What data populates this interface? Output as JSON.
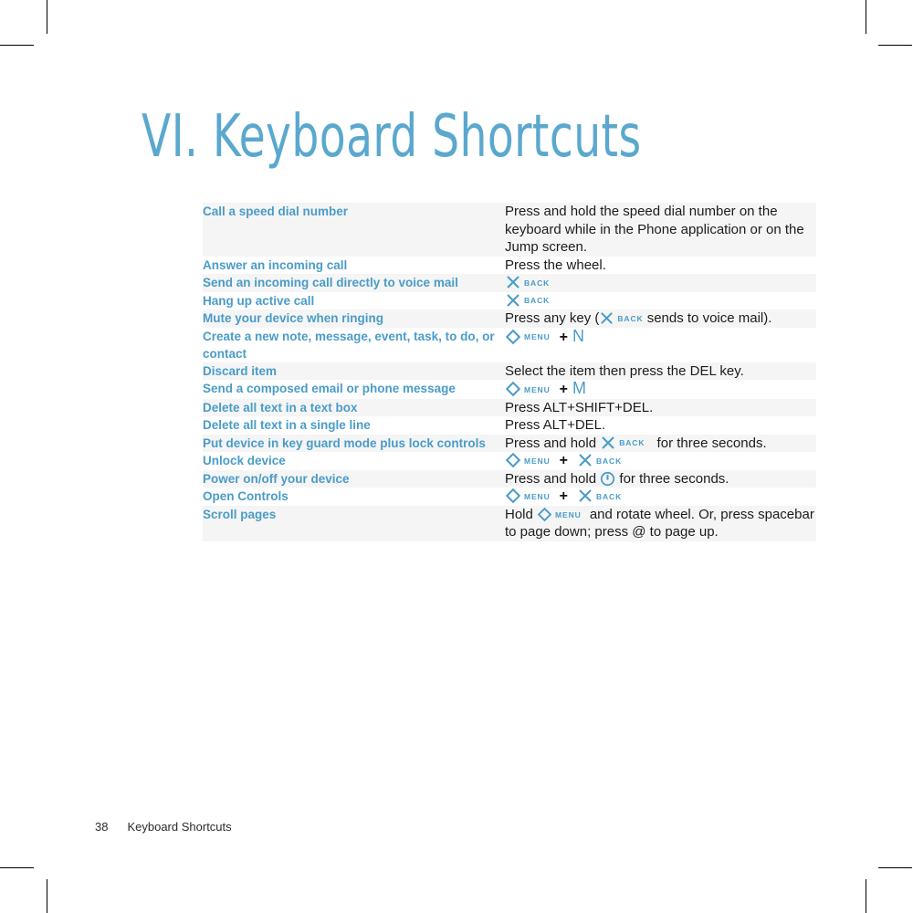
{
  "page": {
    "title": "VI. Keyboard Shortcuts",
    "footer_page_number": "38",
    "footer_section": "Keyboard Shortcuts"
  },
  "colors": {
    "accent_blue": "#4a9cc8",
    "title_blue": "#5aa8ce",
    "stripe_gray": "#f5f5f5",
    "body_black": "#1c1c1c"
  },
  "keys": {
    "back_label": "BACK",
    "menu_label": "MENU",
    "plus": "+",
    "power_label": "power"
  },
  "table": {
    "rows": [
      {
        "action": "Call a speed dial number",
        "desc_text": "Press and hold the speed dial number on the keyboard while in the Phone application or on the Jump screen."
      },
      {
        "action": "Answer an incoming call",
        "desc_text": "Press the wheel."
      },
      {
        "action": "Send an incoming call directly to voice mail",
        "desc_text": ""
      },
      {
        "action": "Hang up active call",
        "desc_text": ""
      },
      {
        "action": "Mute your device when ringing",
        "desc_prefix": "Press any key (",
        "desc_suffix": " sends to voice mail)."
      },
      {
        "action": "Create a new note, message, event, task, to do, or contact",
        "combo_char": "N"
      },
      {
        "action": "Discard item",
        "desc_text": "Select the item then press the DEL key."
      },
      {
        "action": "Send a composed email or phone message",
        "combo_char": "M"
      },
      {
        "action": "Delete all text in a text box",
        "desc_text": "Press ALT+SHIFT+DEL."
      },
      {
        "action": "Delete all text in a single line",
        "desc_text": "Press ALT+DEL."
      },
      {
        "action": "Put device in key guard mode plus lock controls",
        "desc_prefix": "Press and hold ",
        "desc_suffix": " for three seconds."
      },
      {
        "action": "Unlock device",
        "desc_text": ""
      },
      {
        "action": "Power on/off your device",
        "desc_prefix": "Press and hold ",
        "desc_suffix": " for three seconds."
      },
      {
        "action": "Open Controls",
        "desc_text": ""
      },
      {
        "action": "Scroll pages",
        "desc_prefix": "Hold ",
        "desc_suffix": " and rotate wheel. Or, press spacebar to page down; press @ to page up."
      }
    ]
  }
}
